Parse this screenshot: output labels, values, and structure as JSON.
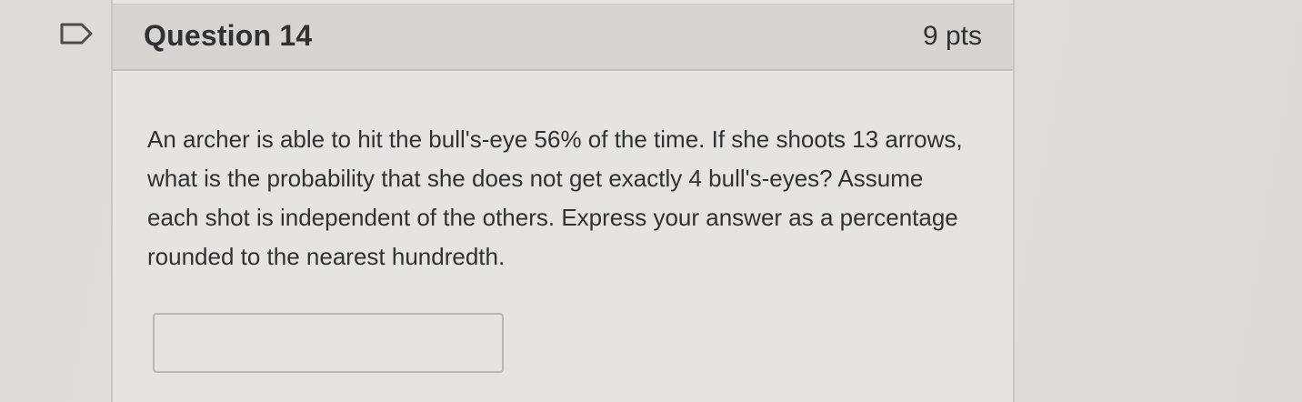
{
  "question": {
    "title": "Question 14",
    "points": "9 pts",
    "flag_icon": "flag-icon",
    "body": "An archer is able to hit the bull's-eye 56% of the time. If she shoots 13 arrows, what is the probability that she does not get exactly 4 bull's-eyes? Assume each shot is independent of the others. Express your answer as a percentage rounded to the nearest hundredth.",
    "answer_value": ""
  }
}
